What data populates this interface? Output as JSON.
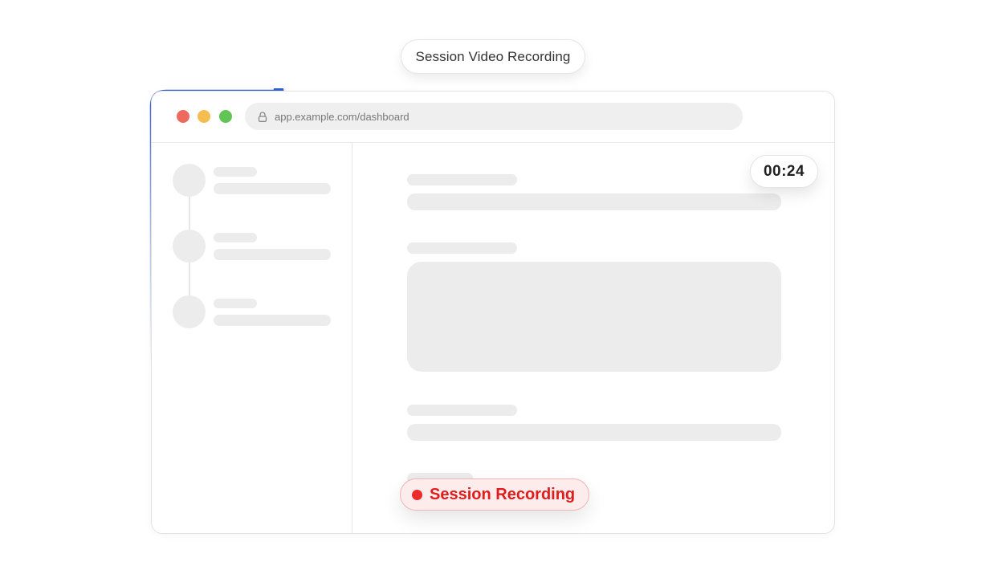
{
  "top_label": "Session Video Recording",
  "browser": {
    "url": "app.example.com/dashboard"
  },
  "timer": "00:24",
  "recording_badge": {
    "label": "Session Recording"
  },
  "colors": {
    "accent_blue": "#2f5fd0",
    "recording_red": "#e01c1c",
    "traffic_red": "#ee6a5f",
    "traffic_yellow": "#f5bd4f",
    "traffic_green": "#61c454"
  },
  "icons": {
    "url_lock": "lock-icon",
    "recording_indicator": "record-dot-icon"
  }
}
